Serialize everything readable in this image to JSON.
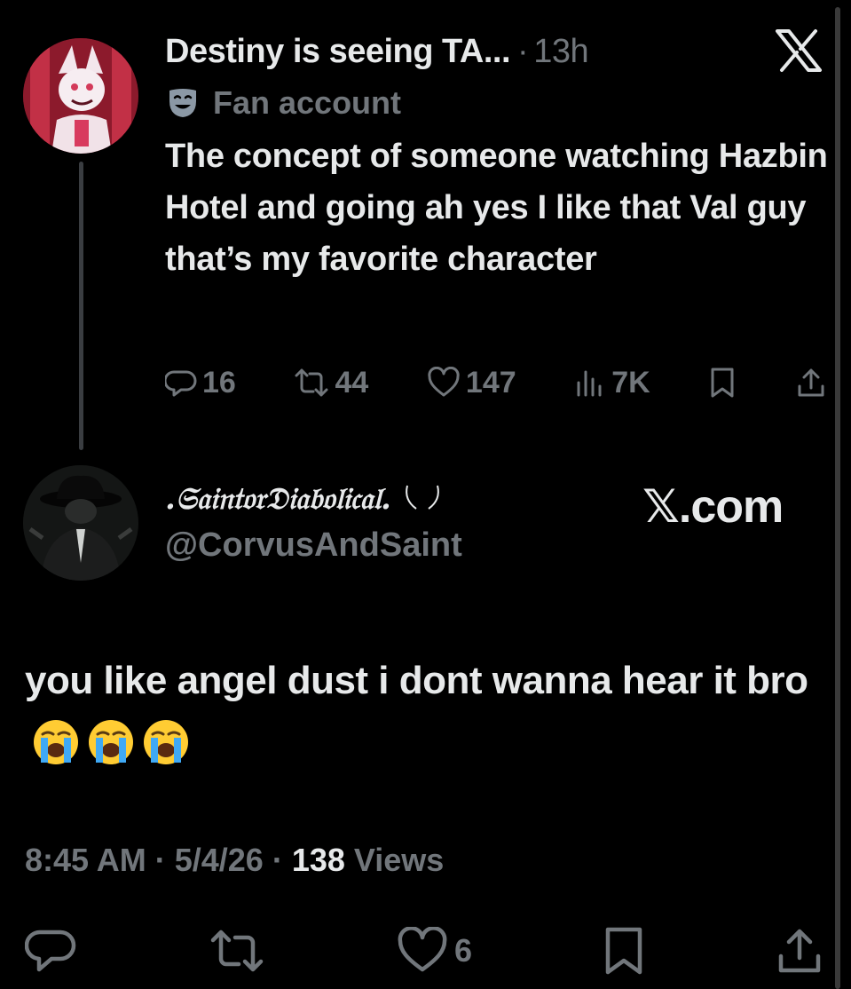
{
  "colors": {
    "background": "#000000",
    "text": "#e7e9ea",
    "muted": "#71767b"
  },
  "parent_tweet": {
    "display_name": "Destiny is seeing TA...",
    "separator": "·",
    "time": "13h",
    "label": "Fan account",
    "label_icon": "theater-mask-icon",
    "text": "The concept of someone watching Hazbin Hotel and going ah yes I like that Val guy that’s my favorite character",
    "stats": {
      "replies": "16",
      "reposts": "44",
      "likes": "147",
      "views": "7K"
    }
  },
  "reply_tweet": {
    "display_name": ".𝔖𝔞𝔦𝔫𝔱𝔬𝔯𝔇𝔦𝔞𝔟𝔬𝔩𝔦𝔠𝔞𝔩.",
    "handle": "@CorvusAndSaint",
    "text": "you like angel dust i dont wanna hear it bro",
    "emoji": "loudly-crying-face",
    "time": "8:45 AM",
    "separator": "·",
    "date": "5/4/26",
    "views_count": "138",
    "views_label": "Views",
    "likes": "6"
  },
  "watermark": {
    "text": "𝕏.com"
  }
}
